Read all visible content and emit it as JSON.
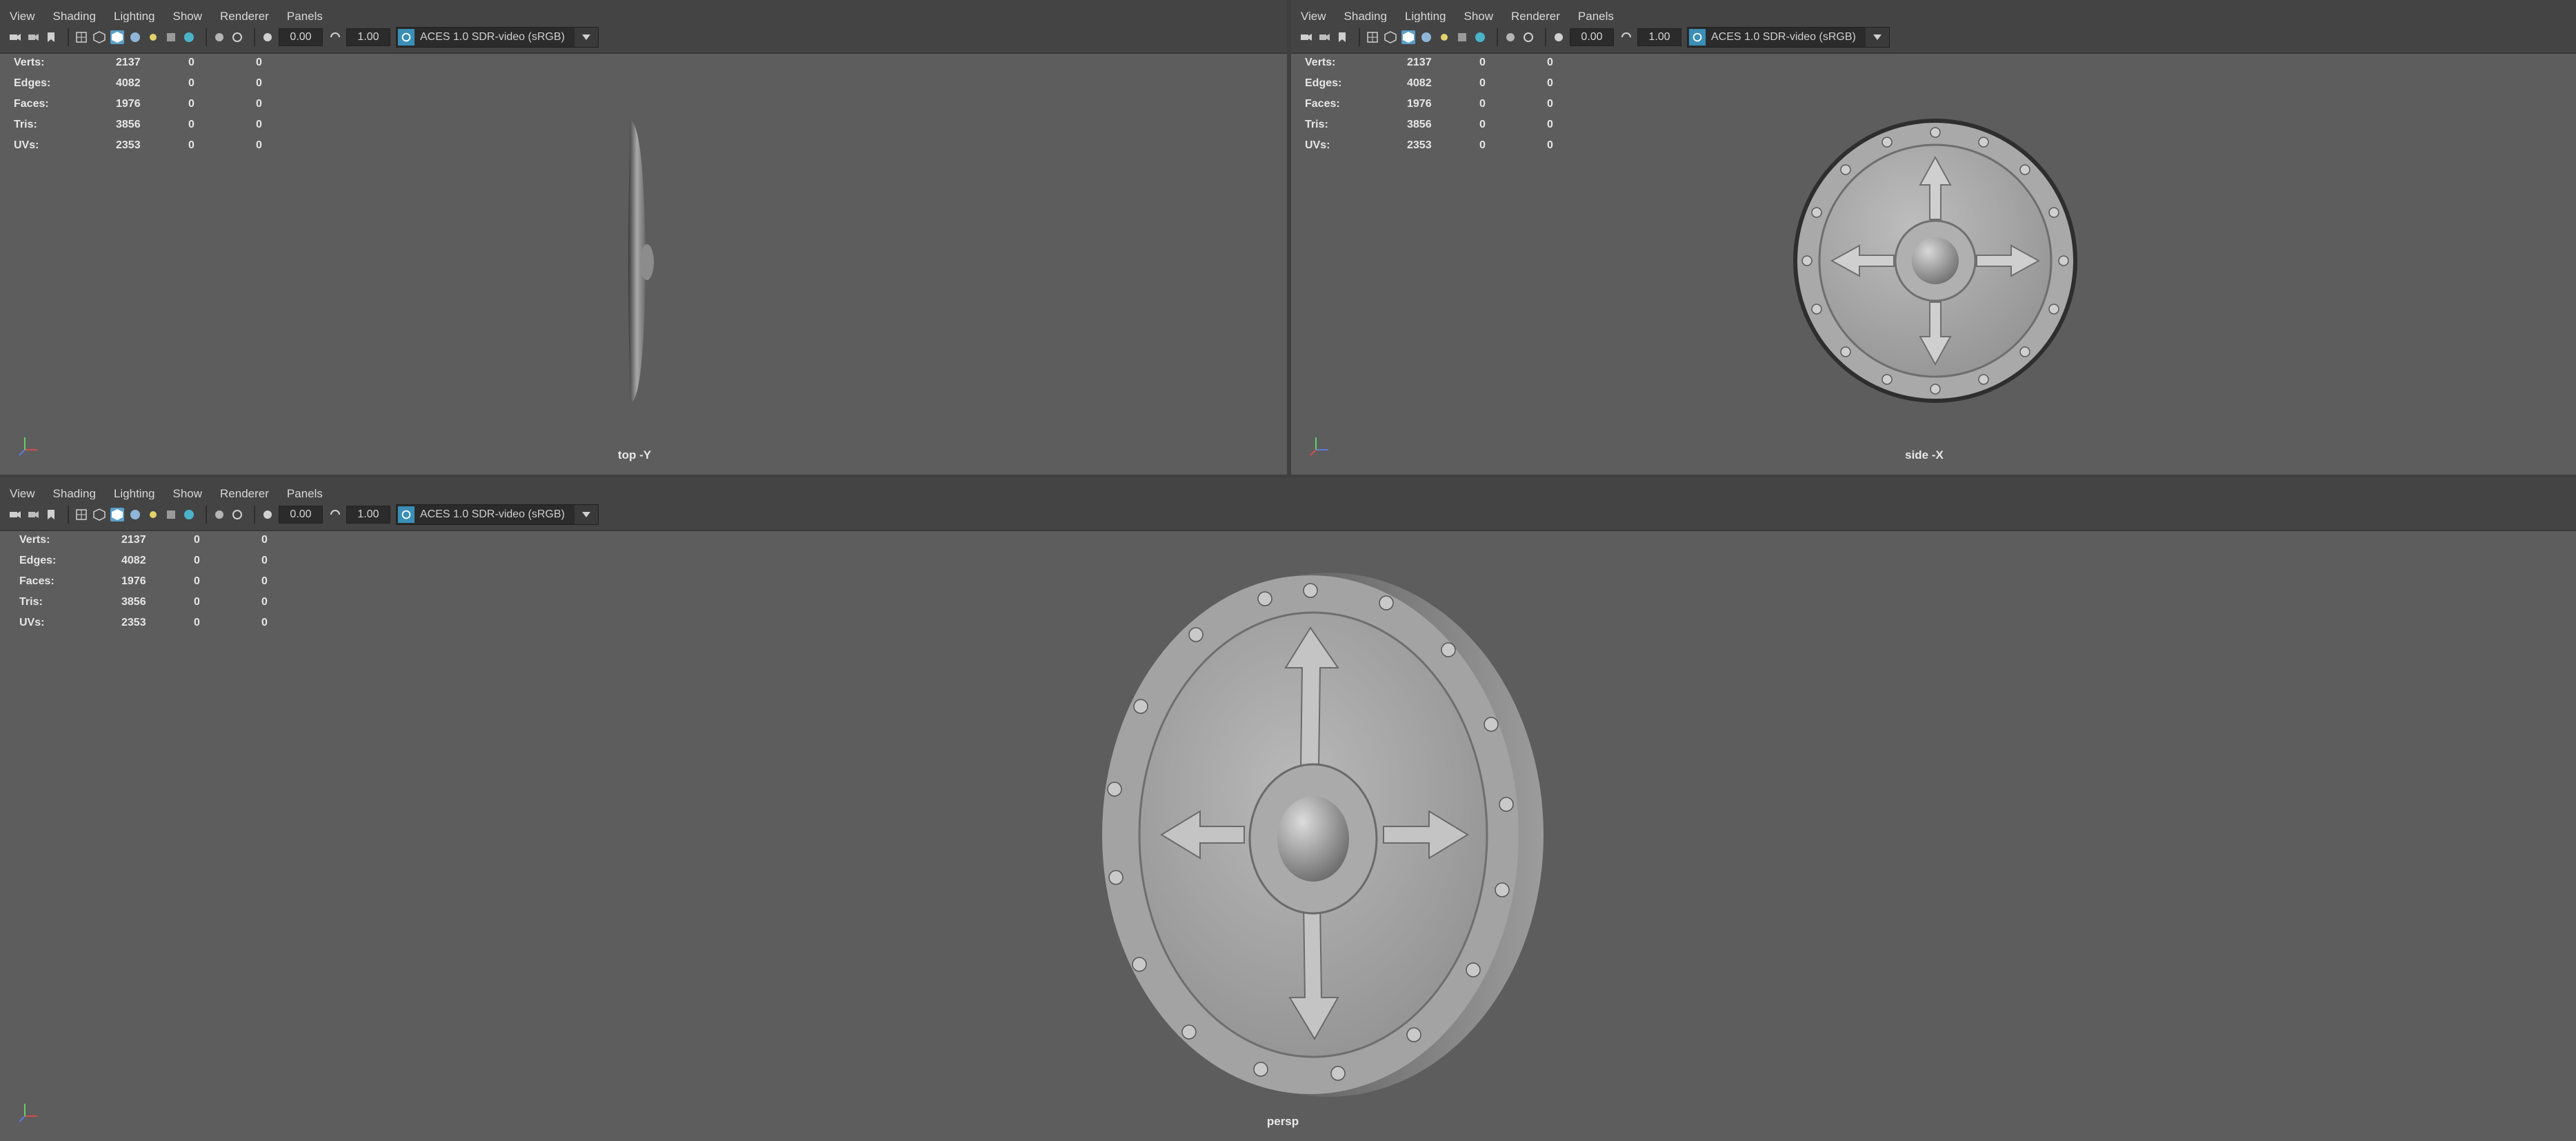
{
  "menu": [
    "View",
    "Shading",
    "Lighting",
    "Show",
    "Renderer",
    "Panels"
  ],
  "toolbar": {
    "exposure": "0.00",
    "gamma": "1.00",
    "color_management": "ACES 1.0 SDR-video (sRGB)"
  },
  "stats": [
    {
      "label": "Verts:",
      "v1": "2137",
      "v2": "0",
      "v3": "0"
    },
    {
      "label": "Edges:",
      "v1": "4082",
      "v2": "0",
      "v3": "0"
    },
    {
      "label": "Faces:",
      "v1": "1976",
      "v2": "0",
      "v3": "0"
    },
    {
      "label": "Tris:",
      "v1": "3856",
      "v2": "0",
      "v3": "0"
    },
    {
      "label": "UVs:",
      "v1": "2353",
      "v2": "0",
      "v3": "0"
    }
  ],
  "viewports": [
    {
      "id": "top",
      "camera_label": "top -Y"
    },
    {
      "id": "side",
      "camera_label": "side -X"
    },
    {
      "id": "persp",
      "camera_label": "persp"
    }
  ],
  "colors": {
    "viewport_bg": "#5d5d5d",
    "panel_bar": "#444444",
    "active_icon": "#5aa0c8",
    "axis_x": "#d94b4b",
    "axis_y": "#5fd35f",
    "axis_z": "#5a7bdc"
  },
  "icons": [
    "camera-icon",
    "select-camera-icon",
    "bookmark-icon",
    "grid-icon",
    "wireframe-icon",
    "smooth-shade-icon",
    "textured-icon",
    "lighting-icon",
    "shadow-icon",
    "ambient-occlusion-icon",
    "isolate-select-icon",
    "xray-icon",
    "exposure-icon",
    "gamma-icon",
    "color-management-icon"
  ]
}
